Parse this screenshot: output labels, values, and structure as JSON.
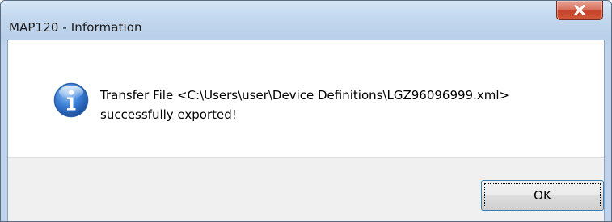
{
  "window": {
    "title": "MAP120 - Information"
  },
  "dialog": {
    "icon": "information-icon",
    "message_line1": "Transfer File <C:\\Users\\user\\Device Definitions\\LGZ96096999.xml>",
    "message_line2": "successfully exported!",
    "ok_label": "OK"
  },
  "colors": {
    "titlebar": "#c4d8ee",
    "close_button": "#c4412a",
    "button_area": "#f0f0f0",
    "icon_blue": "#2f6fc8"
  }
}
